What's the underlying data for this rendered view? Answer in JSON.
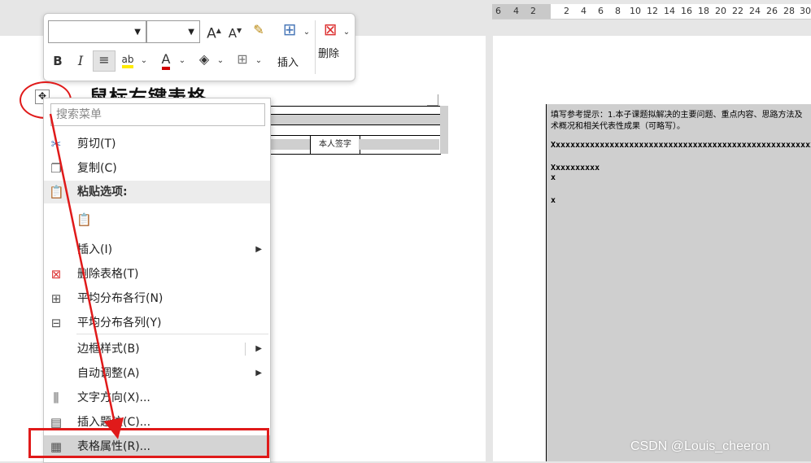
{
  "ruler": {
    "ticks": [
      "6",
      "4",
      "2",
      "2",
      "4",
      "6",
      "8",
      "10",
      "12",
      "14",
      "16",
      "18",
      "20",
      "22",
      "24",
      "26",
      "28",
      "30"
    ]
  },
  "toolbar": {
    "font_name": "",
    "font_size": "",
    "grow_font": "A",
    "shrink_font": "A",
    "bold": "B",
    "italic": "I",
    "insert_label": "插入",
    "delete_label": "删除",
    "highlight_glyph": "ab",
    "font_color_glyph": "A"
  },
  "annotation": {
    "text": "鼠标右键表格"
  },
  "document_left": {
    "signature_cell": "本人签字"
  },
  "document_right": {
    "hint_line1": "填写参考提示：1.本子课题拟解决的主要问题、重点内容、思路方法及",
    "hint_line2": "术概况和相关代表性成果（可略写）。",
    "x_line1": "Xxxxxxxxxxxxxxxxxxxxxxxxxxxxxxxxxxxxxxxxxxxxxxxxxxxxxxxxxxxxxxxxxxxxxxxxxxx",
    "x_line2": "Xxxxxxxxxx",
    "x_line3": "x",
    "x_line4": "x"
  },
  "context_menu": {
    "search_placeholder": "搜索菜单",
    "items": [
      {
        "label": "剪切(T)",
        "icon": "scissors-icon"
      },
      {
        "label": "复制(C)",
        "icon": "copy-icon"
      },
      {
        "label": "粘贴选项:",
        "icon": "paste-icon"
      },
      {
        "label": "插入(I)",
        "icon": ""
      },
      {
        "label": "删除表格(T)",
        "icon": "delete-table-icon"
      },
      {
        "label": "平均分布各行(N)",
        "icon": "distribute-rows-icon"
      },
      {
        "label": "平均分布各列(Y)",
        "icon": "distribute-columns-icon"
      },
      {
        "label": "边框样式(B)",
        "icon": ""
      },
      {
        "label": "自动调整(A)",
        "icon": ""
      },
      {
        "label": "文字方向(X)...",
        "icon": "text-direction-icon"
      },
      {
        "label": "插入题注(C)...",
        "icon": "caption-icon"
      },
      {
        "label": "表格属性(R)...",
        "icon": "table-properties-icon"
      }
    ]
  },
  "watermark": "CSDN @Louis_cheeron",
  "colors": {
    "annotation_red": "#e01a1a",
    "menu_selected": "#d4d4d4",
    "doc_shading": "#cfcfcf"
  }
}
